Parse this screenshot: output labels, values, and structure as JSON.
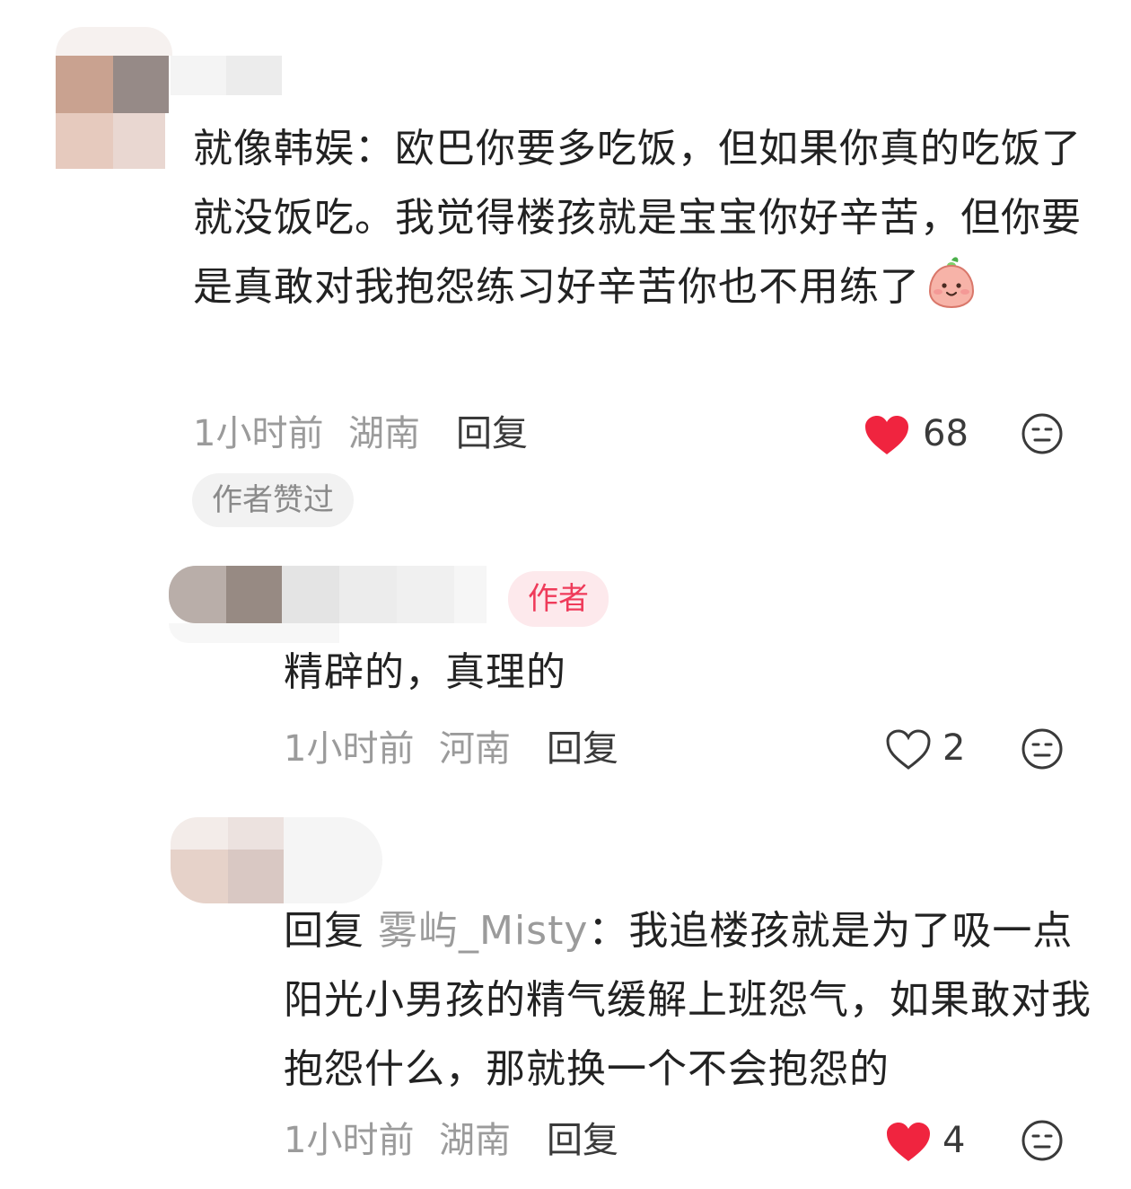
{
  "comments": [
    {
      "text": "就像韩娱：欧巴你要多吃饭，但如果你真的吃饭了就没饭吃。我觉得楼孩就是宝宝你好辛苦，但你要是真敢对我抱怨练习好辛苦你也不用练了",
      "emoji": "face-with-sprout",
      "time": "1小时前",
      "location": "湖南",
      "reply_label": "回复",
      "likes": "68",
      "liked": true,
      "tag": "作者赞过"
    },
    {
      "badge": "作者",
      "text": "精辟的，真理的",
      "time": "1小时前",
      "location": "河南",
      "reply_label": "回复",
      "likes": "2",
      "liked": false
    },
    {
      "reply_prefix": "回复",
      "mention": "雾屿_Misty",
      "colon": "：",
      "text": "我追楼孩就是为了吸一点阳光小男孩的精气缓解上班怨气，如果敢对我抱怨什么，那就换一个不会抱怨的",
      "time": "1小时前",
      "location": "湖南",
      "reply_label": "回复",
      "likes": "4",
      "liked": true
    }
  ],
  "colors": {
    "like_red": "#f0243f",
    "badge_bg": "#fde9ec",
    "badge_text": "#ef3b5a",
    "meta_gray": "#9b9b9b"
  },
  "icons": {
    "liked": "heart-filled-icon",
    "not_liked": "heart-outline-icon",
    "reaction": "emoji-face-icon"
  }
}
